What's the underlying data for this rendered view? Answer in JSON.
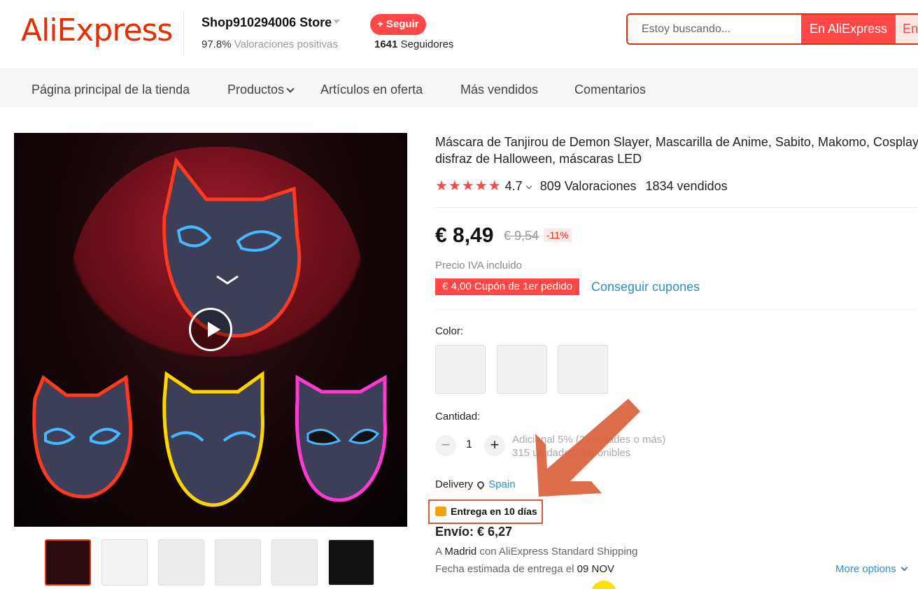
{
  "header": {
    "logo": "AliExpress",
    "store_name": "Shop910294006 Store",
    "rating_pct": "97.8%",
    "rating_text": "Valoraciones positivas",
    "follow_label": "+ Seguir",
    "followers_count": "1641",
    "followers_label": "Seguidores",
    "search_placeholder": "Estoy buscando...",
    "search_btn_aliexpress": "En AliExpress",
    "search_btn_store": "En"
  },
  "nav": {
    "items": [
      "Página principal de la tienda",
      "Productos",
      "Artículos en oferta",
      "Más vendidos",
      "Comentarios"
    ]
  },
  "product": {
    "title": "Máscara de Tanjirou de Demon Slayer, Mascarilla de Anime, Sabito, Makomo, Cosplay, disfraz de Halloween, máscaras LED",
    "stars": "★★★★★",
    "rating": "4.7",
    "reviews": "809 Valoraciones",
    "sold": "1834 vendidos",
    "price": "€ 8,49",
    "old_price": "€ 9,54",
    "discount": "-11%",
    "vat_note": "Precio IVA incluido",
    "coupon": "€ 4,00 Cupón de 1er pedido",
    "coupon_link": "Conseguir cupones",
    "color_label": "Color:",
    "quantity_label": "Cantidad:",
    "quantity": "1",
    "qty_info_1": "Adicional 5% (2 unidades o más)",
    "qty_info_2": "315 unidades disponibles",
    "delivery_label": "Delivery",
    "delivery_location": "Spain",
    "delivery_badge": "Entrega en 10 días",
    "shipping": "Envío: € 6,27",
    "ship_to_prefix": "A",
    "ship_to_city": "Madrid",
    "ship_to_suffix": "con AliExpress Standard Shipping",
    "eta_prefix": "Fecha estimada de entrega el",
    "eta_date": "09 NOV",
    "more_options": "More options"
  },
  "colors": {
    "brand": "#e62e04",
    "accent": "#ff4747",
    "link": "#2e8fc6",
    "annotation_arrow": "#d9623f"
  }
}
